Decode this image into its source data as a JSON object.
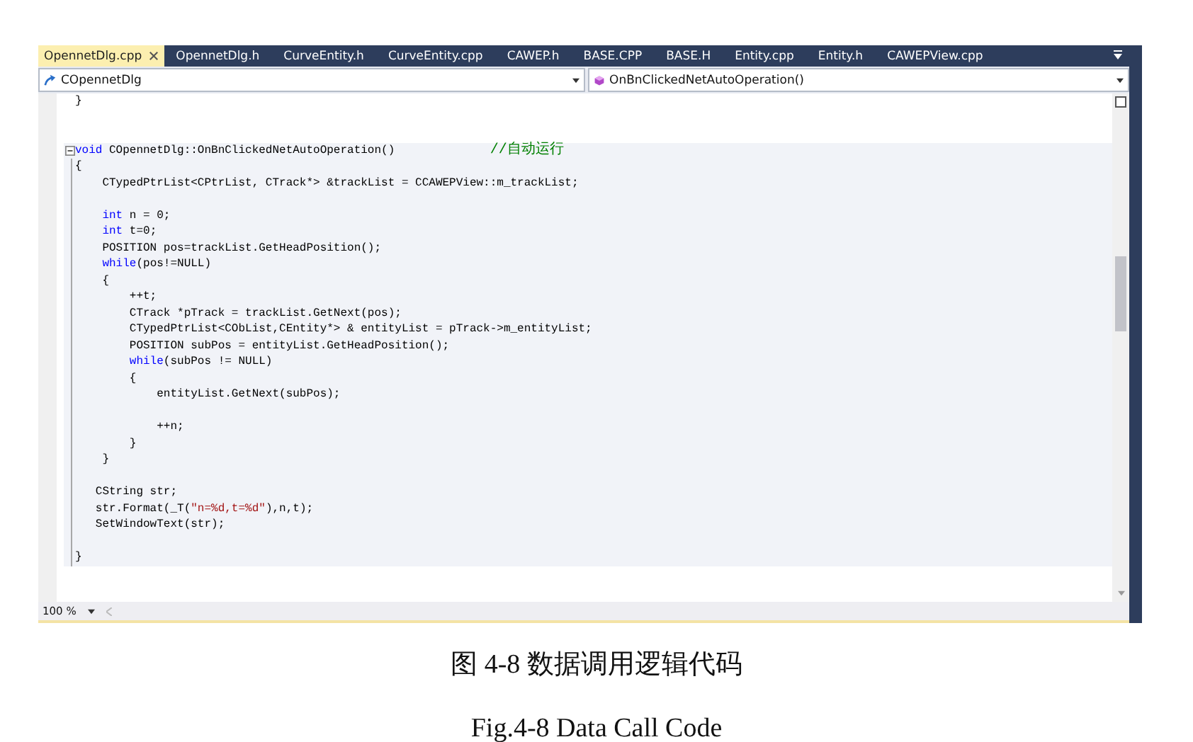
{
  "tabs": [
    {
      "label": "OpennetDlg.cpp",
      "selected": true,
      "closable": true
    },
    {
      "label": "OpennetDlg.h",
      "selected": false,
      "closable": false
    },
    {
      "label": "CurveEntity.h",
      "selected": false,
      "closable": false
    },
    {
      "label": "CurveEntity.cpp",
      "selected": false,
      "closable": false
    },
    {
      "label": "CAWEP.h",
      "selected": false,
      "closable": false
    },
    {
      "label": "BASE.CPP",
      "selected": false,
      "closable": false
    },
    {
      "label": "BASE.H",
      "selected": false,
      "closable": false
    },
    {
      "label": "Entity.cpp",
      "selected": false,
      "closable": false
    },
    {
      "label": "Entity.h",
      "selected": false,
      "closable": false
    },
    {
      "label": "CAWEPView.cpp",
      "selected": false,
      "closable": false
    }
  ],
  "navigation": {
    "scope": "COpennetDlg",
    "member": "OnBnClickedNetAutoOperation()"
  },
  "code_blocks": [
    {
      "highlighted": false,
      "lines": [
        {
          "kind": "code",
          "tokens": [
            {
              "kind": "text",
              "text": "}"
            }
          ]
        },
        {
          "kind": "blank"
        },
        {
          "kind": "blank"
        }
      ]
    },
    {
      "highlighted": true,
      "folded": false,
      "lines": [
        {
          "kind": "code",
          "tokens": [
            {
              "kind": "keyword",
              "text": "void"
            },
            {
              "kind": "text",
              "text": " COpennetDlg::OnBnClickedNetAutoOperation()              "
            },
            {
              "kind": "comment",
              "text": "//自动运行"
            }
          ]
        },
        {
          "kind": "code",
          "tokens": [
            {
              "kind": "text",
              "text": "{"
            }
          ]
        },
        {
          "kind": "code",
          "tokens": [
            {
              "kind": "text",
              "text": "    CTypedPtrList<CPtrList, CTrack*> &trackList = CCAWEPView::m_trackList;"
            }
          ]
        },
        {
          "kind": "blank"
        },
        {
          "kind": "code",
          "tokens": [
            {
              "kind": "keyword",
              "text": "    int"
            },
            {
              "kind": "text",
              "text": " n = 0;"
            }
          ]
        },
        {
          "kind": "code",
          "tokens": [
            {
              "kind": "keyword",
              "text": "    int"
            },
            {
              "kind": "text",
              "text": " t=0;"
            }
          ]
        },
        {
          "kind": "code",
          "tokens": [
            {
              "kind": "text",
              "text": "    POSITION pos=trackList.GetHeadPosition();"
            }
          ]
        },
        {
          "kind": "code",
          "tokens": [
            {
              "kind": "keyword",
              "text": "    while"
            },
            {
              "kind": "text",
              "text": "(pos!=NULL)"
            }
          ]
        },
        {
          "kind": "code",
          "tokens": [
            {
              "kind": "text",
              "text": "    {"
            }
          ]
        },
        {
          "kind": "code",
          "tokens": [
            {
              "kind": "text",
              "text": "        ++t;"
            }
          ]
        },
        {
          "kind": "code",
          "tokens": [
            {
              "kind": "text",
              "text": "        CTrack *pTrack = trackList.GetNext(pos);"
            }
          ]
        },
        {
          "kind": "code",
          "tokens": [
            {
              "kind": "text",
              "text": "        CTypedPtrList<CObList,CEntity*> & entityList = pTrack->m_entityList;"
            }
          ]
        },
        {
          "kind": "code",
          "tokens": [
            {
              "kind": "text",
              "text": "        POSITION subPos = entityList.GetHeadPosition();"
            }
          ]
        },
        {
          "kind": "code",
          "tokens": [
            {
              "kind": "keyword",
              "text": "        while"
            },
            {
              "kind": "text",
              "text": "(subPos != NULL)"
            }
          ]
        },
        {
          "kind": "code",
          "tokens": [
            {
              "kind": "text",
              "text": "        {"
            }
          ]
        },
        {
          "kind": "code",
          "tokens": [
            {
              "kind": "text",
              "text": "            entityList.GetNext(subPos);"
            }
          ]
        },
        {
          "kind": "blank"
        },
        {
          "kind": "code",
          "tokens": [
            {
              "kind": "text",
              "text": "            ++n;"
            }
          ]
        },
        {
          "kind": "code",
          "tokens": [
            {
              "kind": "text",
              "text": "        }"
            }
          ]
        },
        {
          "kind": "code",
          "tokens": [
            {
              "kind": "text",
              "text": "    }"
            }
          ]
        },
        {
          "kind": "blank"
        },
        {
          "kind": "code",
          "tokens": [
            {
              "kind": "text",
              "text": "   CString str;"
            }
          ]
        },
        {
          "kind": "code",
          "tokens": [
            {
              "kind": "text",
              "text": "   str.Format(_T("
            },
            {
              "kind": "string",
              "text": "\"n=%d,t=%d\""
            },
            {
              "kind": "text",
              "text": "),n,t);"
            }
          ]
        },
        {
          "kind": "code",
          "tokens": [
            {
              "kind": "text",
              "text": "   SetWindowText(str);"
            }
          ]
        },
        {
          "kind": "blank"
        },
        {
          "kind": "code",
          "tokens": [
            {
              "kind": "text",
              "text": "}"
            }
          ]
        }
      ]
    }
  ],
  "status_bar": {
    "zoom": "100 %"
  },
  "caption": {
    "chinese": "图 4-8  数据调用逻辑代码",
    "english": "Fig.4-8 Data Call Code"
  }
}
